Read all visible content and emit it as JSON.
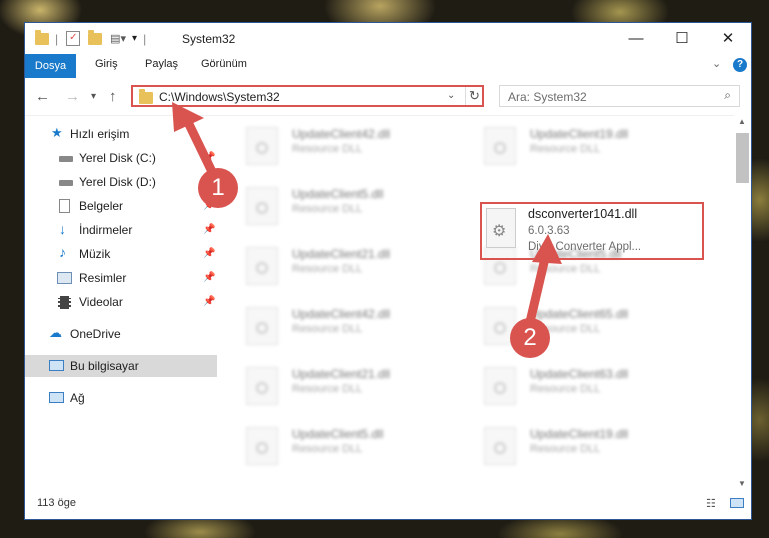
{
  "window": {
    "title": "System32"
  },
  "ribbon": {
    "tabs": [
      "Dosya",
      "Giriş",
      "Paylaş",
      "Görünüm"
    ]
  },
  "address": {
    "path": "C:\\Windows\\System32"
  },
  "search": {
    "placeholder": "Ara: System32"
  },
  "sidebar": {
    "quick_access": "Hızlı erişim",
    "items": [
      "Yerel Disk (C:)",
      "Yerel Disk (D:)",
      "Belgeler",
      "İndirmeler",
      "Müzik",
      "Resimler",
      "Videolar"
    ],
    "onedrive": "OneDrive",
    "this_pc": "Bu bilgisayar",
    "network": "Ağ"
  },
  "files": {
    "left": [
      {
        "name": "UpdateClient42.dll",
        "desc": "Resource DLL"
      },
      {
        "name": "UpdateClient5.dll",
        "desc": "Resource DLL"
      },
      {
        "name": "UpdateClient21.dll",
        "desc": "Resource DLL"
      },
      {
        "name": "UpdateClient42.dll",
        "desc": "Resource DLL"
      },
      {
        "name": "UpdateClient21.dll",
        "desc": "Resource DLL"
      },
      {
        "name": "UpdateClient5.dll",
        "desc": "Resource DLL"
      }
    ],
    "right": [
      {
        "name": "UpdateClient19.dll",
        "desc": "Resource DLL"
      },
      {
        "name": "UpdateClient5.dll",
        "desc": "Resource DLL"
      },
      {
        "name": "UpdateClient65.dll",
        "desc": "Resource DLL"
      },
      {
        "name": "UpdateClient63.dll",
        "desc": "Resource DLL"
      },
      {
        "name": "UpdateClient19.dll",
        "desc": "Resource DLL"
      }
    ],
    "highlighted": {
      "name": "dsconverter1041.dll",
      "version": "6.0.3.63",
      "desc": "DivX Converter Appl..."
    }
  },
  "status": {
    "count": "113 öge"
  },
  "badges": {
    "one": "1",
    "two": "2"
  },
  "colors": {
    "accent": "#1979ca",
    "highlight": "#d9534f"
  }
}
